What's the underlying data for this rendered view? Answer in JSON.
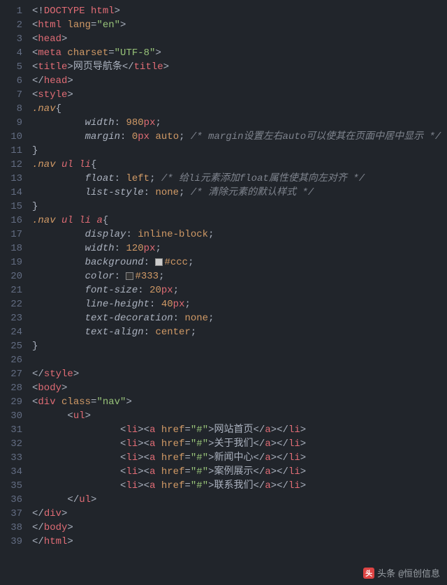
{
  "lines": [
    {
      "n": 1,
      "t": "doctype",
      "content": "DOCTYPE html"
    },
    {
      "n": 2,
      "t": "open",
      "tag": "html",
      "attrs": [
        {
          "name": "lang",
          "val": "en"
        }
      ],
      "indent": 0
    },
    {
      "n": 3,
      "t": "open",
      "tag": "head",
      "indent": 0
    },
    {
      "n": 4,
      "t": "self",
      "tag": "meta",
      "attrs": [
        {
          "name": "charset",
          "val": "UTF-8"
        }
      ],
      "indent": 0
    },
    {
      "n": 5,
      "t": "pair",
      "tag": "title",
      "text": "网页导航条",
      "indent": 0
    },
    {
      "n": 6,
      "t": "close",
      "tag": "head",
      "indent": 0
    },
    {
      "n": 7,
      "t": "open",
      "tag": "style",
      "indent": 0
    },
    {
      "n": 8,
      "t": "sel",
      "sel": ".nav",
      "indent": 0
    },
    {
      "n": 9,
      "t": "decl",
      "prop": "width",
      "val": [
        {
          "k": "num",
          "v": "980"
        },
        {
          "k": "unit",
          "v": "px"
        }
      ],
      "indent": 2
    },
    {
      "n": 10,
      "t": "decl",
      "prop": "margin",
      "val": [
        {
          "k": "num",
          "v": "0"
        },
        {
          "k": "unit",
          "v": "px"
        },
        {
          "k": "sp"
        },
        {
          "k": "kw",
          "v": "auto"
        }
      ],
      "indent": 2,
      "comment": "/* margin设置左右auto可以使其在页面中居中显示 */"
    },
    {
      "n": 11,
      "t": "brace-close",
      "indent": 0
    },
    {
      "n": 12,
      "t": "sel",
      "sel": ".nav ul li",
      "indent": 0
    },
    {
      "n": 13,
      "t": "decl",
      "prop": "float",
      "val": [
        {
          "k": "kw",
          "v": "left"
        }
      ],
      "indent": 2,
      "comment": "/* 给li元素添加float属性使其向左对齐 */"
    },
    {
      "n": 14,
      "t": "decl",
      "prop": "list-style",
      "val": [
        {
          "k": "kw",
          "v": "none"
        }
      ],
      "indent": 2,
      "comment": "/* 清除元素的默认样式 */"
    },
    {
      "n": 15,
      "t": "brace-close",
      "indent": 0
    },
    {
      "n": 16,
      "t": "sel",
      "sel": ".nav ul li a",
      "indent": 0
    },
    {
      "n": 17,
      "t": "decl",
      "prop": "display",
      "val": [
        {
          "k": "kw",
          "v": "inline-block"
        }
      ],
      "indent": 2
    },
    {
      "n": 18,
      "t": "decl",
      "prop": "width",
      "val": [
        {
          "k": "num",
          "v": "120"
        },
        {
          "k": "unit",
          "v": "px"
        }
      ],
      "indent": 2
    },
    {
      "n": 19,
      "t": "decl",
      "prop": "background",
      "val": [
        {
          "k": "sw",
          "v": "#ccc"
        },
        {
          "k": "hex",
          "v": "#ccc"
        }
      ],
      "indent": 2
    },
    {
      "n": 20,
      "t": "decl",
      "prop": "color",
      "val": [
        {
          "k": "sw",
          "v": "#333"
        },
        {
          "k": "hex",
          "v": "#333"
        }
      ],
      "indent": 2
    },
    {
      "n": 21,
      "t": "decl",
      "prop": "font-size",
      "val": [
        {
          "k": "num",
          "v": "20"
        },
        {
          "k": "unit",
          "v": "px"
        }
      ],
      "indent": 2
    },
    {
      "n": 22,
      "t": "decl",
      "prop": "line-height",
      "val": [
        {
          "k": "num",
          "v": "40"
        },
        {
          "k": "unit",
          "v": "px"
        }
      ],
      "indent": 2
    },
    {
      "n": 23,
      "t": "decl",
      "prop": "text-decoration",
      "val": [
        {
          "k": "kw",
          "v": "none"
        }
      ],
      "indent": 2
    },
    {
      "n": 24,
      "t": "decl",
      "prop": "text-align",
      "val": [
        {
          "k": "kw",
          "v": "center"
        }
      ],
      "indent": 2
    },
    {
      "n": 25,
      "t": "brace-close",
      "indent": 0
    },
    {
      "n": 26,
      "t": "blank"
    },
    {
      "n": 27,
      "t": "close",
      "tag": "style",
      "indent": 0
    },
    {
      "n": 28,
      "t": "open",
      "tag": "body",
      "indent": 0
    },
    {
      "n": 29,
      "t": "open",
      "tag": "div",
      "attrs": [
        {
          "name": "class",
          "val": "nav"
        }
      ],
      "indent": 0
    },
    {
      "n": 30,
      "t": "open",
      "tag": "ul",
      "indent": 2
    },
    {
      "n": 31,
      "t": "li",
      "text": "网站首页",
      "indent": 4
    },
    {
      "n": 32,
      "t": "li",
      "text": "关于我们",
      "indent": 4
    },
    {
      "n": 33,
      "t": "li",
      "text": "新闻中心",
      "indent": 4
    },
    {
      "n": 34,
      "t": "li",
      "text": "案例展示",
      "indent": 4
    },
    {
      "n": 35,
      "t": "li",
      "text": "联系我们",
      "indent": 4
    },
    {
      "n": 36,
      "t": "close",
      "tag": "ul",
      "indent": 2
    },
    {
      "n": 37,
      "t": "close",
      "tag": "div",
      "indent": 0
    },
    {
      "n": 38,
      "t": "close",
      "tag": "body",
      "indent": 0
    },
    {
      "n": 39,
      "t": "close",
      "tag": "html",
      "indent": 0
    }
  ],
  "watermark": {
    "brand": "头条",
    "handle": "@恒创信息"
  }
}
